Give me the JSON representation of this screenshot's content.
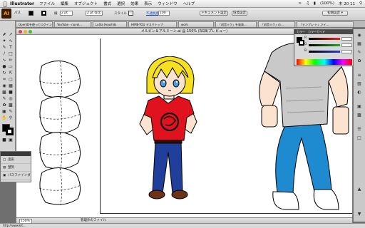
{
  "menubar": {
    "apple": "",
    "app_name": "Illustrator",
    "items": [
      "ファイル",
      "編集",
      "オブジェクト",
      "書式",
      "選択",
      "効果",
      "表示",
      "ウィンドウ",
      "ヘルプ"
    ],
    "battery": "(100%)",
    "clock": "木 20 11"
  },
  "controlbar": {
    "logo": "Ai",
    "stroke_label": "線",
    "stroke_value": "2 pt 等比",
    "style_label": "スタイル",
    "opacity_label": "不透明度",
    "opacity_value": "100",
    "doc_setup_button": "ドキュメント設定",
    "prefs_button": "環境設定",
    "workspace_button": "初期設定 ▾"
  },
  "browser_tabs": [
    "OpenIDを使ってログイン…",
    "YouTube - novel…",
    "Lolita Houshiki",
    "HIME-YOU デスクトップ",
    "work",
    "「初音ミク」を発表…",
    "「初音ミク」の…",
    "「テンプレ-ト」ツイ…"
  ],
  "document": {
    "title": "メルビン＆アルミーン.ai @ 150% (RGB/プレビュー)",
    "zoom": "150%",
    "status_text": "管理外のファイル"
  },
  "layers_panel": {
    "items": [
      "変形",
      "整列",
      "パスファインダ"
    ]
  },
  "color_panel": {
    "tabs": [
      "カラー",
      "カラーガイド"
    ],
    "channels": [
      {
        "label": "R",
        "value": "",
        "color": "#e0261e"
      },
      {
        "label": "G",
        "value": "",
        "color": "#2aa52a"
      },
      {
        "label": "B",
        "value": "",
        "color": "#2540c8"
      }
    ]
  },
  "bottom_bar": {
    "url": "http://www.kit..."
  },
  "colors": {
    "hair": "#f7e01f",
    "shirt": "#e0121e",
    "jeans": "#1f3f9a",
    "boots": "#6b3318",
    "skin": "#fce3cf",
    "shirt_grey": "#c9c9c9",
    "pants_blue": "#1e8bd0"
  }
}
